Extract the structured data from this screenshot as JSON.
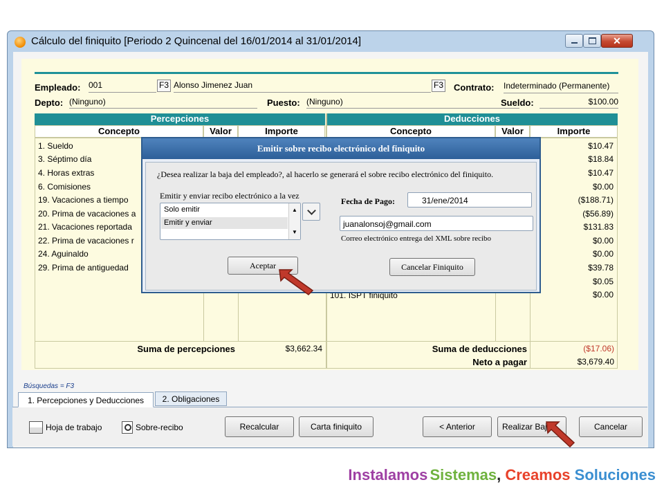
{
  "window": {
    "title": "Cálculo del finiquito  [Periodo 2 Quincenal del 16/01/2014 al 31/01/2014]",
    "close_label": "✕"
  },
  "header": {
    "empleado_label": "Empleado:",
    "empleado_id": "001",
    "f3_1": "F3",
    "empleado_nombre": "Alonso Jimenez Juan",
    "f3_2": "F3",
    "contrato_label": "Contrato:",
    "contrato_value": "Indeterminado (Permanente)",
    "depto_label": "Depto:",
    "depto_value": "(Ninguno)",
    "puesto_label": "Puesto:",
    "puesto_value": "(Ninguno)",
    "sueldo_label": "Sueldo:",
    "sueldo_value": "$100.00"
  },
  "percepciones": {
    "title": "Percepciones",
    "col_concepto": "Concepto",
    "col_valor": "Valor",
    "col_importe": "Importe",
    "rows": [
      "1. Sueldo",
      "3. Séptimo día",
      "4. Horas extras",
      "6. Comisiones",
      "19. Vacaciones a tiempo",
      "20. Prima de vacaciones a",
      "21. Vacaciones reportada",
      "22. Prima de vacaciones r",
      "24. Aguinaldo",
      "29. Prima de antiguedad"
    ],
    "suma_label": "Suma de percepciones",
    "suma_value": "$3,662.34"
  },
  "deducciones": {
    "title": "Deducciones",
    "col_concepto": "Concepto",
    "col_valor": "Valor",
    "col_importe": "Importe",
    "importes": [
      "$10.47",
      "$18.84",
      "$10.47",
      "$0.00",
      "($188.71)",
      "($56.89)",
      "$131.83",
      "$0.00",
      "$0.00",
      "$39.78",
      "$0.05",
      "$0.00"
    ],
    "visible_row": "101. ISPT finiquito",
    "suma_label": "Suma de deducciones",
    "suma_value": "($17.06)",
    "neto_label": "Neto a pagar",
    "neto_value": "$3,679.40"
  },
  "busquedas": "Búsquedas = F3",
  "tabs": [
    "1. Percepciones y Deducciones",
    "2. Obligaciones"
  ],
  "toolbar": {
    "hoja": "Hoja de trabajo",
    "sobre": "Sobre-recibo",
    "recalcular": "Recalcular",
    "carta": "Carta finiquito",
    "anterior": "< Anterior",
    "realizar": "Realizar Baja",
    "cancelar": "Cancelar"
  },
  "modal": {
    "title": "Emitir  sobre recibo electrónico del finiquito",
    "question": "¿Desea realizar la baja del empleado?, al hacerlo se  generará el sobre recibo electrónico del finiquito.",
    "emitir_label": "Emitir y enviar recibo electrónico a la vez",
    "options": [
      "Solo emitir",
      "Emitir y enviar"
    ],
    "fecha_label": "Fecha de Pago:",
    "fecha_value": "31/ene/2014",
    "email_value": "juanalonsoj@gmail.com",
    "email_caption": "Correo electrónico entrega del XML sobre recibo",
    "aceptar": "Aceptar",
    "cancelar_finiquito": "Cancelar Finiquito"
  },
  "footer": {
    "w1": "Instalamos",
    "w2": "Sistemas",
    "comma": ",",
    "w3": "Creamos",
    "w4": "Soluciones",
    "colors": {
      "w1": "#9e3fa3",
      "w2": "#6fb23e",
      "w3": "#e8412a",
      "w4": "#3b8fd1"
    }
  },
  "accent_colors": {
    "teal": "#1f8f96",
    "panel": "#fdfbe0",
    "arrow": "#c0392b"
  }
}
